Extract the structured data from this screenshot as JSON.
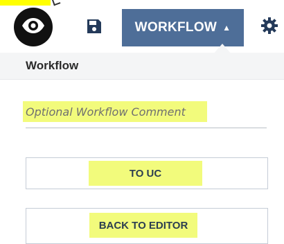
{
  "toolbar": {
    "icons": {
      "eye": "eye-icon",
      "save": "floppy-disk-icon",
      "settings": "gear-icon"
    },
    "workflow_label": "WORKFLOW",
    "workflow_caret": "▲",
    "colors": {
      "tab_bg": "#4e6e98",
      "eye_bg": "#111111"
    }
  },
  "panel": {
    "title": "Workflow",
    "comment_placeholder": "Optional Workflow Comment",
    "buttons": {
      "to_uc": "TO UC",
      "back_to_editor": "BACK TO EDITOR"
    },
    "colors": {
      "highlight": "#f2fb7c",
      "header_bg": "#f4f5f6",
      "button_text": "#2c3e50"
    }
  }
}
